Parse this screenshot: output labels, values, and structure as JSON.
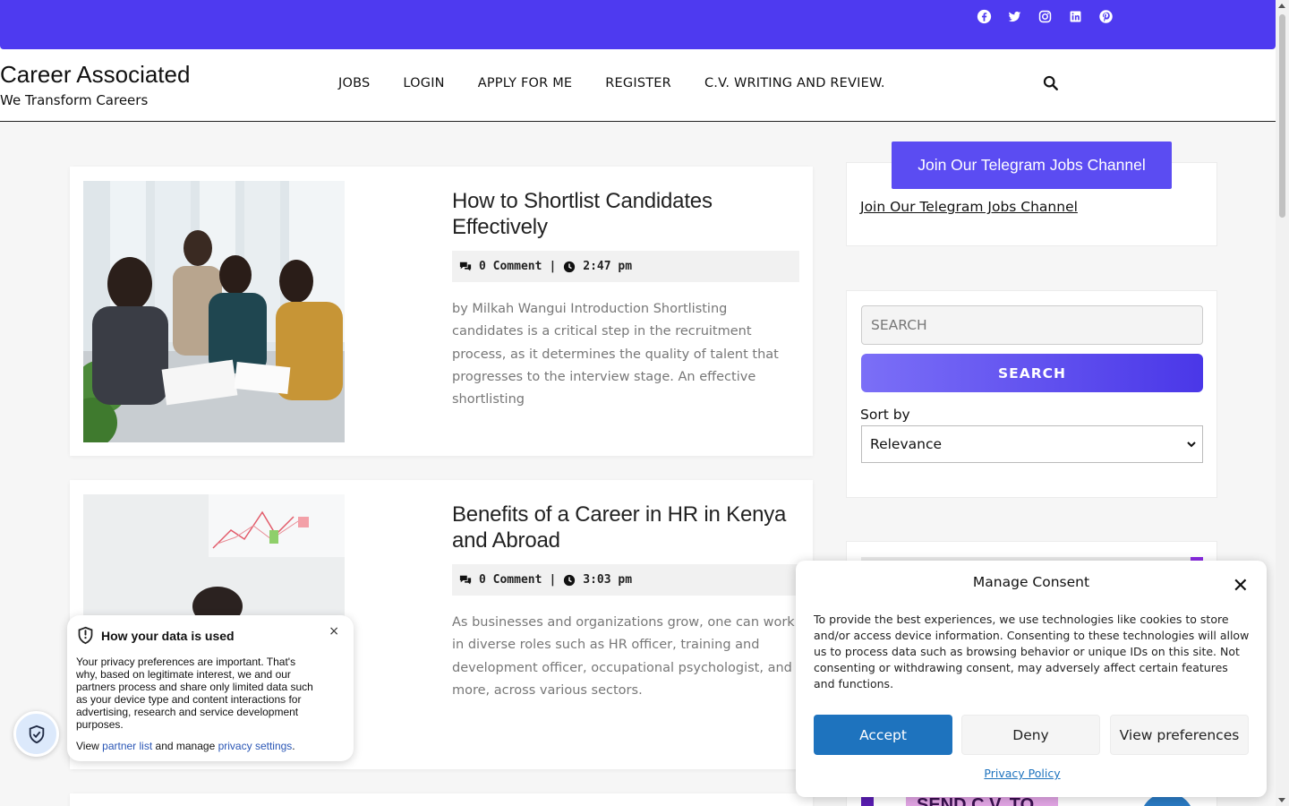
{
  "site": {
    "title": "Career Associated",
    "tagline": "We Transform Careers"
  },
  "social_icons": [
    "facebook-icon",
    "twitter-icon",
    "instagram-icon",
    "linkedin-icon",
    "pinterest-icon"
  ],
  "nav": {
    "items": [
      {
        "label": "JOBS"
      },
      {
        "label": "LOGIN"
      },
      {
        "label": "APPLY FOR ME"
      },
      {
        "label": "REGISTER"
      },
      {
        "label": "C.V. WRITING AND REVIEW."
      }
    ]
  },
  "posts": [
    {
      "title": "How to Shortlist Candidates Effectively",
      "comments": "0 Comment",
      "separator": "|",
      "time": "2:47 pm",
      "excerpt": "by Milkah Wangui Introduction Shortlisting candidates is a critical step in the recruitment process, as it determines the quality of talent that progresses to the interview stage. An effective shortlisting"
    },
    {
      "title": "Benefits of a Career in HR in Kenya and Abroad",
      "comments": "0 Comment",
      "separator": "|",
      "time": "3:03 pm",
      "excerpt": "As businesses and organizations grow, one can work in diverse roles such as HR officer, training and development officer, occupational psychologist, and more, across various sectors."
    }
  ],
  "sidebar": {
    "telegram_button": "Join Our Telegram Jobs Channel",
    "telegram_link": "Join Our Telegram Jobs Channel",
    "search_placeholder": "SEARCH",
    "search_button": "SEARCH",
    "sort_label": "Sort by",
    "sort_value": "Relevance"
  },
  "privacy_popup": {
    "title": "How your data is used",
    "close": "×",
    "text": "Your privacy preferences are important. That's why, based on legitimate interest, we and our partners process and share only limited data such as your device type and content interactions for advertising, research and service development purposes.",
    "view_prefix": "View",
    "partner_list": "partner list",
    "manage_text": "and manage",
    "privacy_settings": "privacy settings",
    "period": "."
  },
  "consent": {
    "title": "Manage Consent",
    "close": "✕",
    "text": "To provide the best experiences, we use technologies like cookies to store and/or access device information. Consenting to these technologies will allow us to process data such as browsing behavior or unique IDs on this site. Not consenting or withdrawing consent, may adversely affect certain features and functions.",
    "accept": "Accept",
    "deny": "Deny",
    "view_preferences": "View preferences",
    "privacy_policy": "Privacy Policy"
  },
  "banner_partial_text": "SEND C.V. TO",
  "colors": {
    "brand": "#4e3af0",
    "accept": "#1e73be",
    "link": "#2a56b5"
  }
}
